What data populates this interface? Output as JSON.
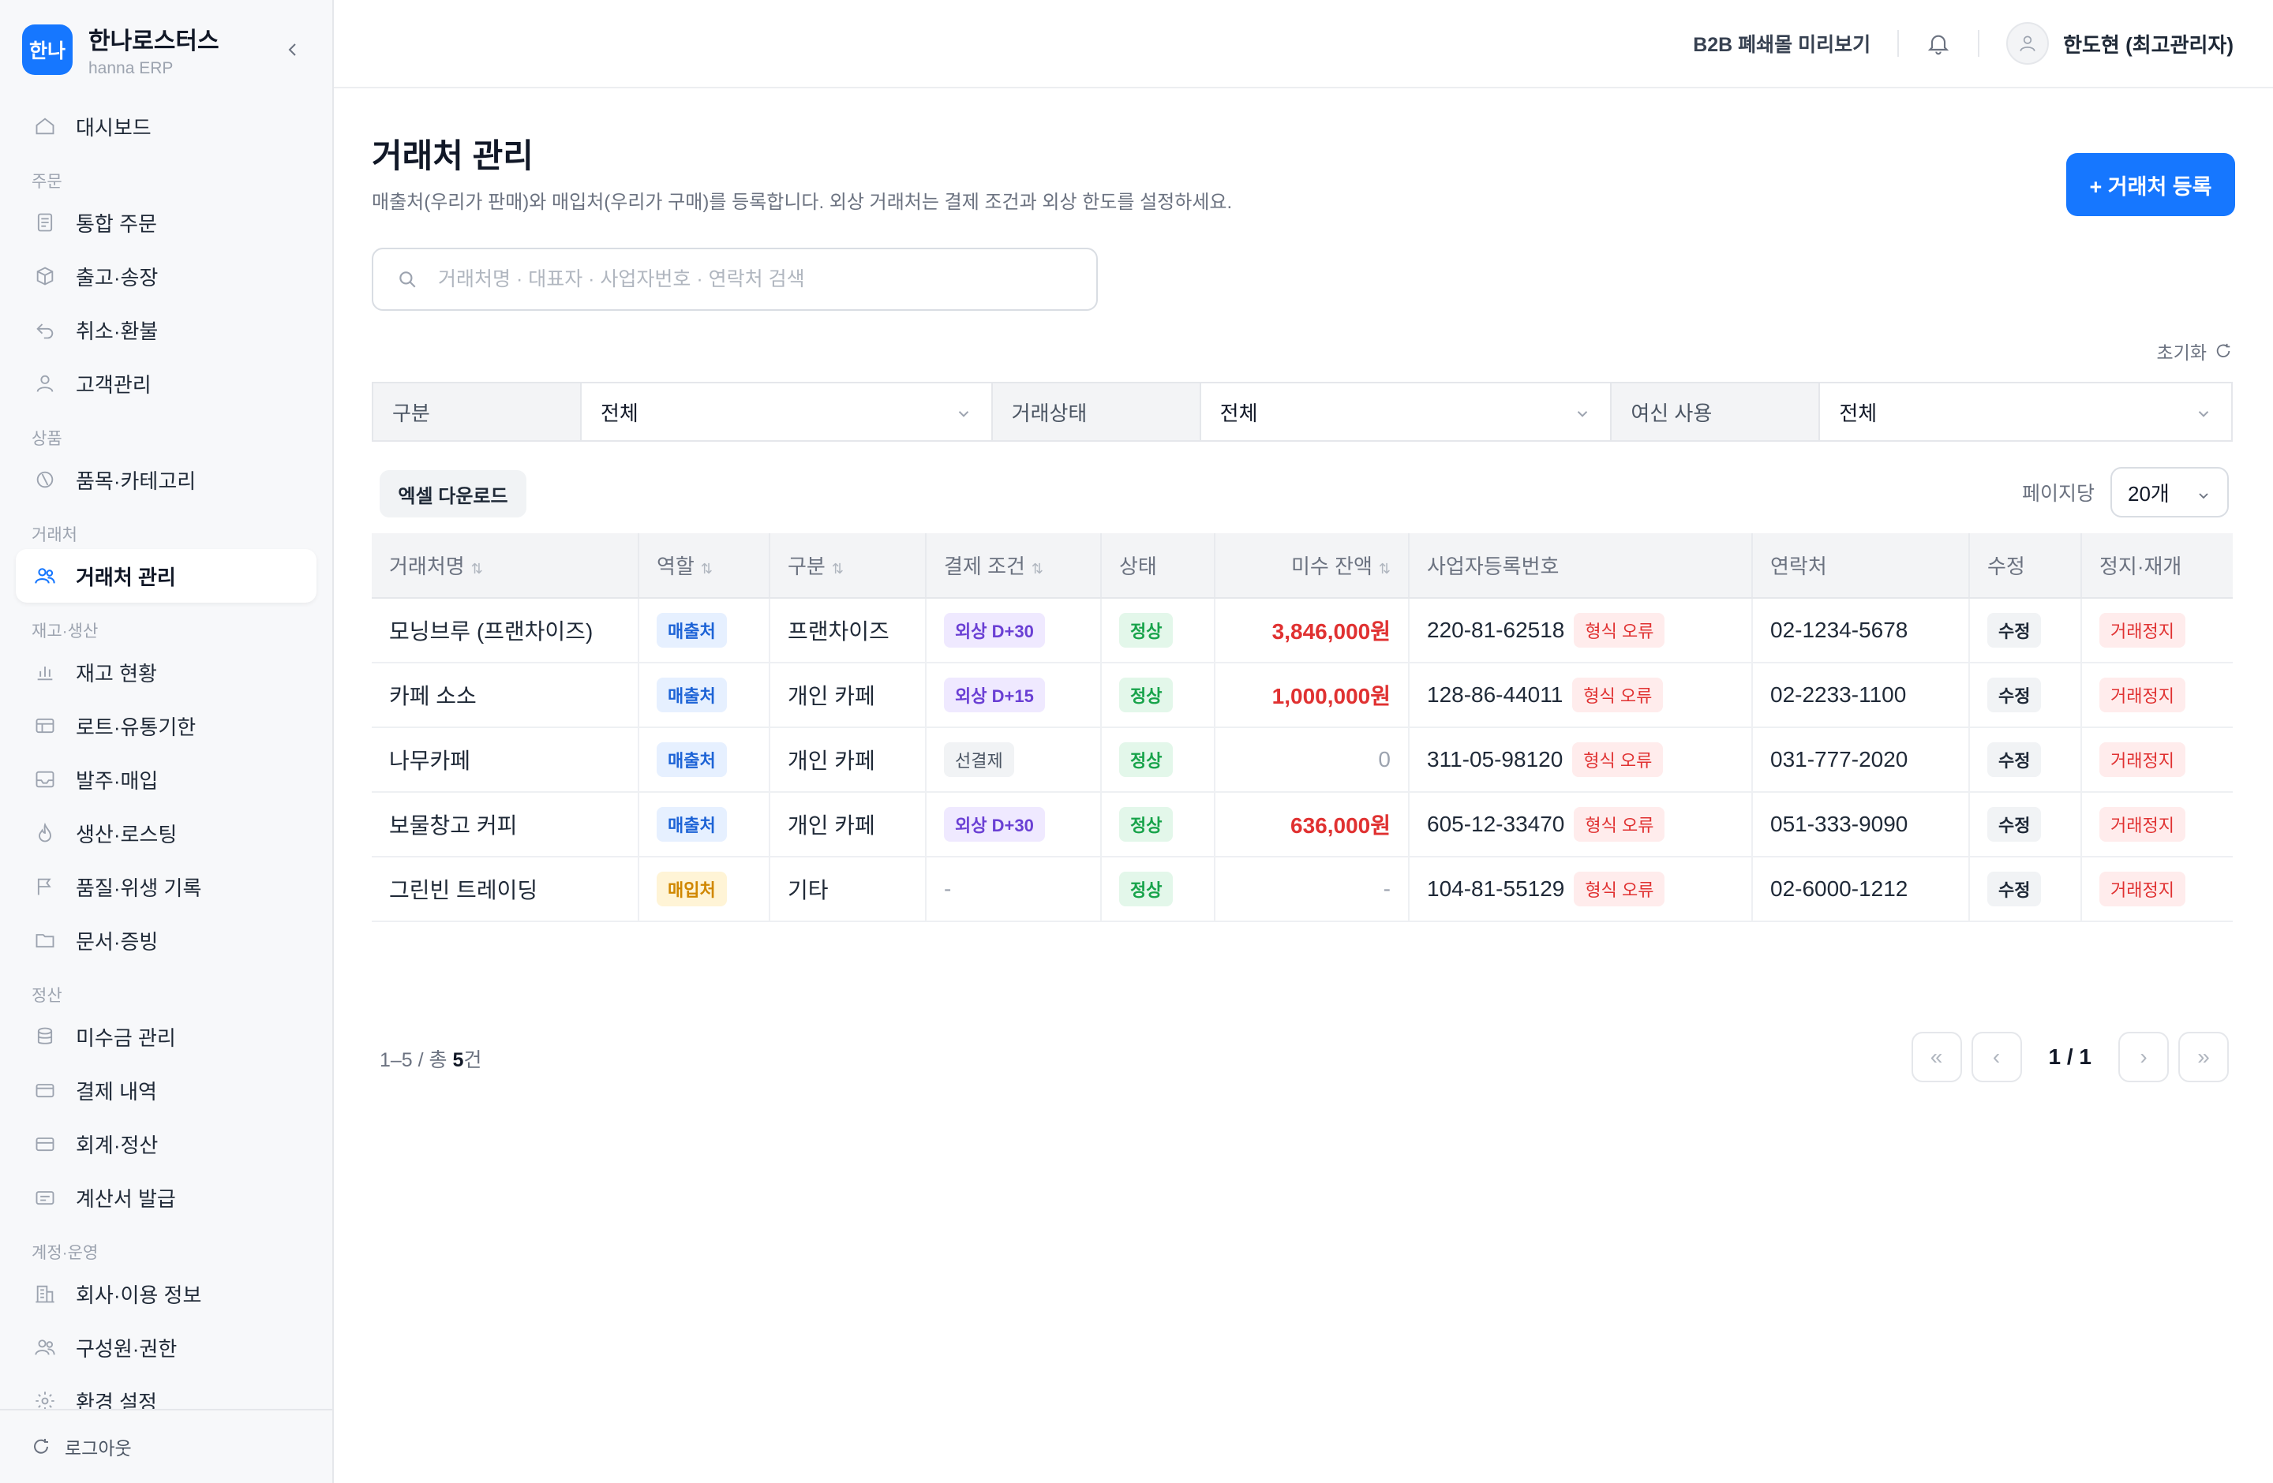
{
  "brand": {
    "logo": "한나",
    "name": "한나로스터스",
    "sub": "hanna ERP",
    "collapse_icon": "chevron-left-icon"
  },
  "nav": {
    "dashboard": "대시보드",
    "sec_order": "주문",
    "orders": "통합 주문",
    "shipping": "출고·송장",
    "refund": "취소·환불",
    "customers": "고객관리",
    "sec_product": "상품",
    "products": "품목·카테고리",
    "sec_partner": "거래처",
    "partners": "거래처 관리",
    "sec_stock": "재고·생산",
    "stock": "재고 현황",
    "lot": "로트·유통기한",
    "purchase": "발주·매입",
    "roasting": "생산·로스팅",
    "quality": "품질·위생 기록",
    "docs": "문서·증빙",
    "sec_settle": "정산",
    "receivables": "미수금 관리",
    "payments": "결제 내역",
    "accounting": "회계·정산",
    "invoice": "계산서 발급",
    "sec_account": "계정·운영",
    "company": "회사·이용 정보",
    "members": "구성원·권한",
    "settings": "환경 설정",
    "logout": "로그아웃"
  },
  "topbar": {
    "preview": "B2B 폐쇄몰 미리보기",
    "user": "한도현 (최고관리자)"
  },
  "page": {
    "title": "거래처 관리",
    "desc": "매출처(우리가 판매)와 매입처(우리가 구매)를 등록합니다. 외상 거래처는 결제 조건과 외상 한도를 설정하세요.",
    "add_button": "+ 거래처 등록",
    "search_placeholder": "거래처명 · 대표자 · 사업자번호 · 연락처 검색",
    "reset": "초기화"
  },
  "filters": [
    {
      "label": "구분",
      "value": "전체"
    },
    {
      "label": "거래상태",
      "value": "전체"
    },
    {
      "label": "여신 사용",
      "value": "전체"
    }
  ],
  "toolbar": {
    "excel": "엑셀 다운로드",
    "perpage_label": "페이지당",
    "perpage_value": "20개"
  },
  "table": {
    "headers": [
      "거래처명",
      "역할",
      "구분",
      "결제 조건",
      "상태",
      "미수 잔액",
      "사업자등록번호",
      "연락처",
      "수정",
      "정지·재개"
    ],
    "rows": [
      {
        "name": "모닝브루 (프랜차이즈)",
        "role": "매출처",
        "type": "프랜차이즈",
        "terms": "외상 D+30",
        "status": "정상",
        "balance": "3,846,000원",
        "biz": "220-81-62518",
        "err": "형식 오류",
        "phone": "02-1234-5678",
        "edit": "수정",
        "stop": "거래정지"
      },
      {
        "name": "카페 소소",
        "role": "매출처",
        "type": "개인 카페",
        "terms": "외상 D+15",
        "status": "정상",
        "balance": "1,000,000원",
        "biz": "128-86-44011",
        "err": "형식 오류",
        "phone": "02-2233-1100",
        "edit": "수정",
        "stop": "거래정지"
      },
      {
        "name": "나무카페",
        "role": "매출처",
        "type": "개인 카페",
        "terms": "선결제",
        "status": "정상",
        "balance": "0",
        "biz": "311-05-98120",
        "err": "형식 오류",
        "phone": "031-777-2020",
        "edit": "수정",
        "stop": "거래정지"
      },
      {
        "name": "보물창고 커피",
        "role": "매출처",
        "type": "개인 카페",
        "terms": "외상 D+30",
        "status": "정상",
        "balance": "636,000원",
        "biz": "605-12-33470",
        "err": "형식 오류",
        "phone": "051-333-9090",
        "edit": "수정",
        "stop": "거래정지"
      },
      {
        "name": "그린빈 트레이딩",
        "role": "매입처",
        "type": "기타",
        "terms": "-",
        "status": "정상",
        "balance": "-",
        "biz": "104-81-55129",
        "err": "형식 오류",
        "phone": "02-6000-1212",
        "edit": "수정",
        "stop": "거래정지"
      }
    ]
  },
  "summary": {
    "prefix": "1–5 / 총 ",
    "count": "5",
    "suffix": "건"
  },
  "pager": {
    "first": "«",
    "prev": "‹",
    "info": "1 / 1",
    "next": "›",
    "last": "»"
  },
  "colors": {
    "accent": "#1677ff",
    "danger": "#e03131",
    "success": "#17a34a"
  }
}
